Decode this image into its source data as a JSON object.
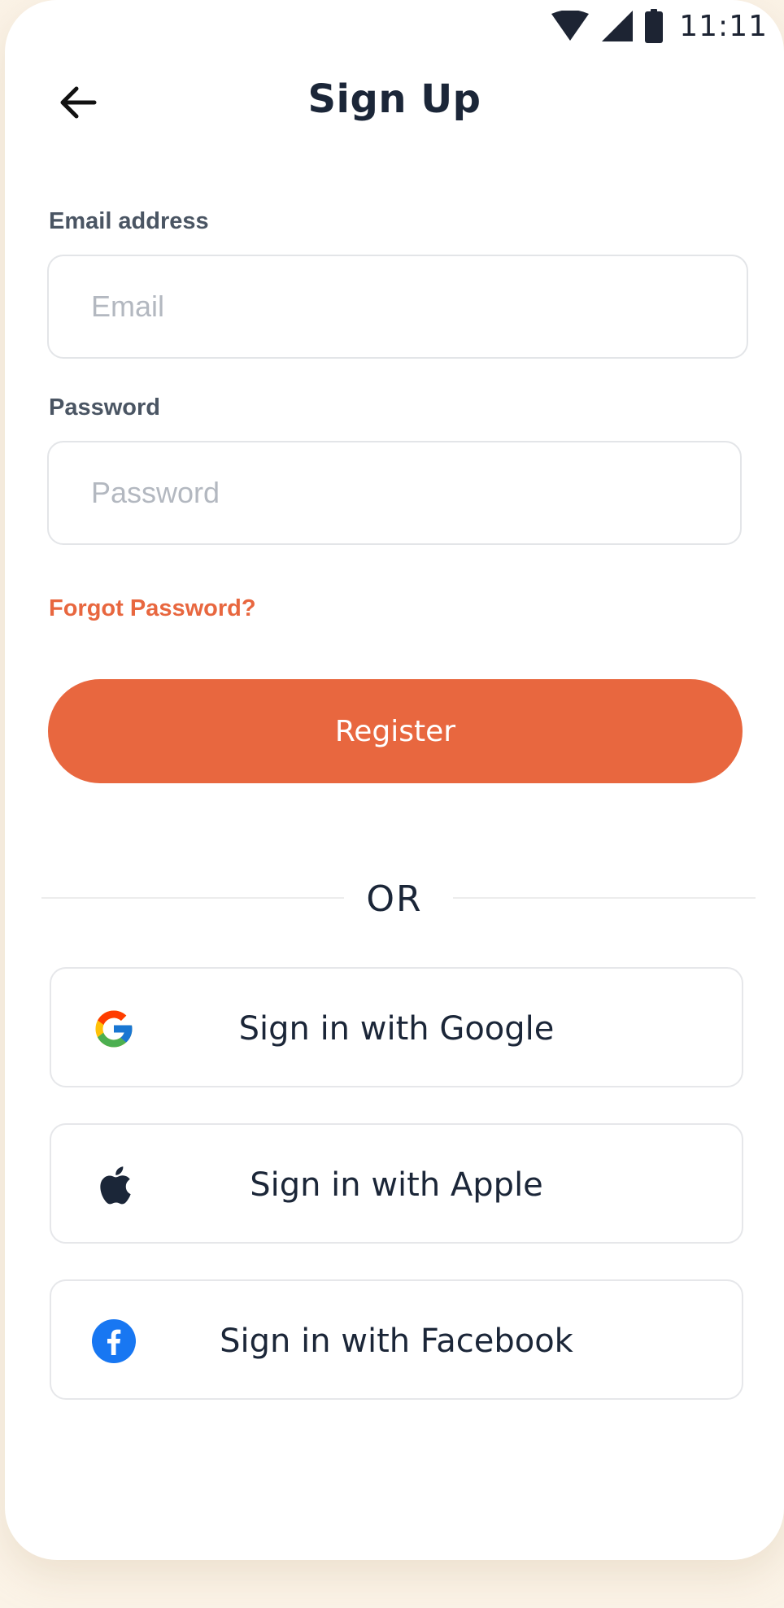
{
  "status_bar": {
    "time": "11:11",
    "icons": [
      "wifi-icon",
      "cell-signal-icon",
      "battery-icon"
    ]
  },
  "header": {
    "title": "Sign Up",
    "back_icon": "arrow-left-icon"
  },
  "form": {
    "email": {
      "label": "Email address",
      "placeholder": "Email",
      "value": ""
    },
    "password": {
      "label": "Password",
      "placeholder": "Password",
      "value": ""
    },
    "forgot_password_label": "Forgot Password?",
    "register_label": "Register"
  },
  "divider": {
    "label": "OR"
  },
  "social": [
    {
      "label": "Sign in with Google",
      "icon": "google-icon"
    },
    {
      "label": "Sign in with Apple",
      "icon": "apple-icon"
    },
    {
      "label": "Sign in with Facebook",
      "icon": "facebook-icon"
    }
  ],
  "colors": {
    "accent": "#e8673f",
    "text_primary": "#1b2638",
    "text_label": "#4a5563",
    "placeholder": "#b3b8c0",
    "border": "#e3e5e8",
    "page_background": "#fbf3e7",
    "facebook_blue": "#1877f2"
  }
}
